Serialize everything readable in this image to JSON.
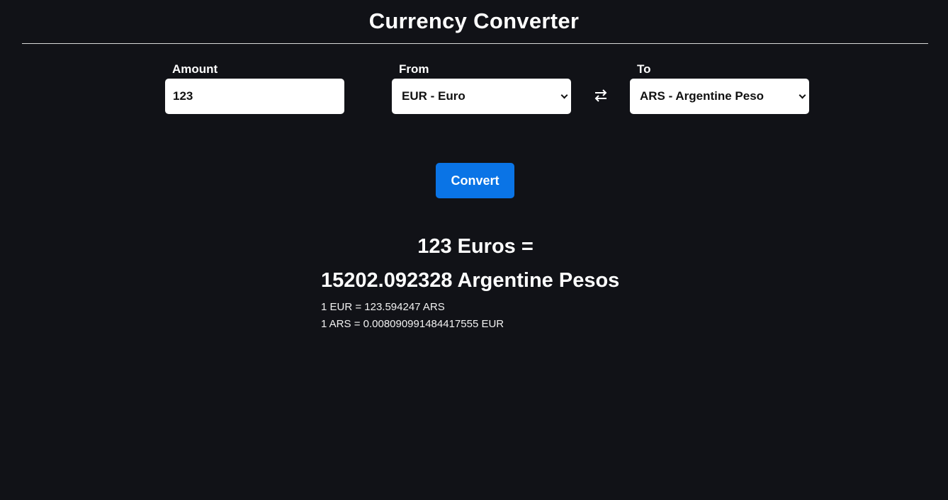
{
  "app": {
    "title": "Currency Converter"
  },
  "form": {
    "amount_label": "Amount",
    "amount_value": "123",
    "from_label": "From",
    "from_selected": "EUR - Euro",
    "to_label": "To",
    "to_selected": "ARS - Argentine Peso",
    "swap_icon": "swap-arrows-icon",
    "convert_label": "Convert"
  },
  "result": {
    "from_text": "123 Euros =",
    "to_text": "15202.092328 Argentine Pesos",
    "rate_forward": "1 EUR = 123.594247 ARS",
    "rate_reverse": "1 ARS = 0.008090991484417555 EUR"
  },
  "colors": {
    "background": "#111217",
    "accent": "#0a74e6",
    "text": "#ffffff"
  }
}
